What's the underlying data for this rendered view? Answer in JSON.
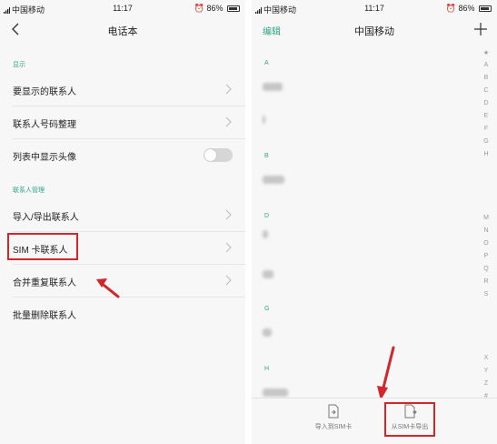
{
  "left_screen": {
    "status": {
      "carrier": "中国移动",
      "time": "11:17",
      "battery": "86%"
    },
    "title": "电话本",
    "section_display": "显示",
    "display_rows": [
      {
        "label": "要显示的联系人"
      },
      {
        "label": "联系人号码整理"
      },
      {
        "label": "列表中显示头像"
      }
    ],
    "section_manage": "联系人管理",
    "manage_rows": [
      {
        "label": "导入/导出联系人"
      },
      {
        "label": "SIM 卡联系人"
      },
      {
        "label": "合并重复联系人"
      },
      {
        "label": "批量删除联系人"
      }
    ],
    "avatar_toggle_on": false
  },
  "right_screen": {
    "status": {
      "carrier": "中国移动",
      "time": "11:17",
      "battery": "86%"
    },
    "edit": "编辑",
    "title": "中国移动",
    "letters": [
      "A",
      "B",
      "D",
      "G",
      "H"
    ],
    "index": [
      "★",
      "A",
      "B",
      "C",
      "D",
      "E",
      "F",
      "G",
      "H",
      "M",
      "N",
      "O",
      "P",
      "Q",
      "R",
      "S",
      "X",
      "Y",
      "Z",
      "#"
    ],
    "bottom": {
      "import_label": "导入到SIM卡",
      "export_label": "从SIM卡导出"
    }
  },
  "colors": {
    "accent": "#2fa584",
    "highlight": "#d1262a"
  },
  "icons": [
    "back-arrow-icon",
    "chevron-right-icon",
    "plus-icon",
    "sim-import-icon",
    "sim-export-icon",
    "red-arrow-icon"
  ]
}
